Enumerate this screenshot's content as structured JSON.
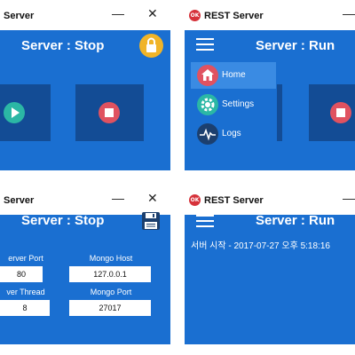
{
  "windows": {
    "top_left": {
      "title": "Server",
      "header": "Server : Stop",
      "close": "✕",
      "minimize": "—",
      "play_icon": "play-icon",
      "stop_icon": "stop-icon",
      "lock_icon": "lock-icon"
    },
    "top_right": {
      "logo": "OK",
      "title": "REST Server",
      "header": "Server : Run",
      "minimize": "—",
      "menu": [
        {
          "label": "Home",
          "icon": "home-icon",
          "color": "#e05260",
          "active": true
        },
        {
          "label": "Settings",
          "icon": "gear-icon",
          "color": "#2bb7a5",
          "active": false
        },
        {
          "label": "Logs",
          "icon": "pulse-icon",
          "color": "#1c3f6e",
          "active": false
        }
      ]
    },
    "bottom_left": {
      "title": "Server",
      "header": "Server : Stop",
      "close": "✕",
      "minimize": "—",
      "save_icon": "floppy-disk-icon",
      "fields": {
        "server_port_label": "erver Port",
        "server_port_value": "80",
        "mongo_host_label": "Mongo Host",
        "mongo_host_value": "127.0.0.1",
        "server_thread_label": "ver Thread",
        "server_thread_value": "8",
        "mongo_port_label": "Mongo Port",
        "mongo_port_value": "27017"
      }
    },
    "bottom_right": {
      "logo": "OK",
      "title": "REST Server",
      "header": "Server : Run",
      "minimize": "—",
      "log": "서버 시작 - 2017-07-27 오후 5:18:16"
    }
  },
  "colors": {
    "window_blue": "#1a6fd1",
    "panel_blue": "#134c95",
    "play_green": "#2bb7a5",
    "stop_red": "#e05260",
    "lock_yellow": "#f0b429",
    "menu_active": "#3a8be3"
  }
}
